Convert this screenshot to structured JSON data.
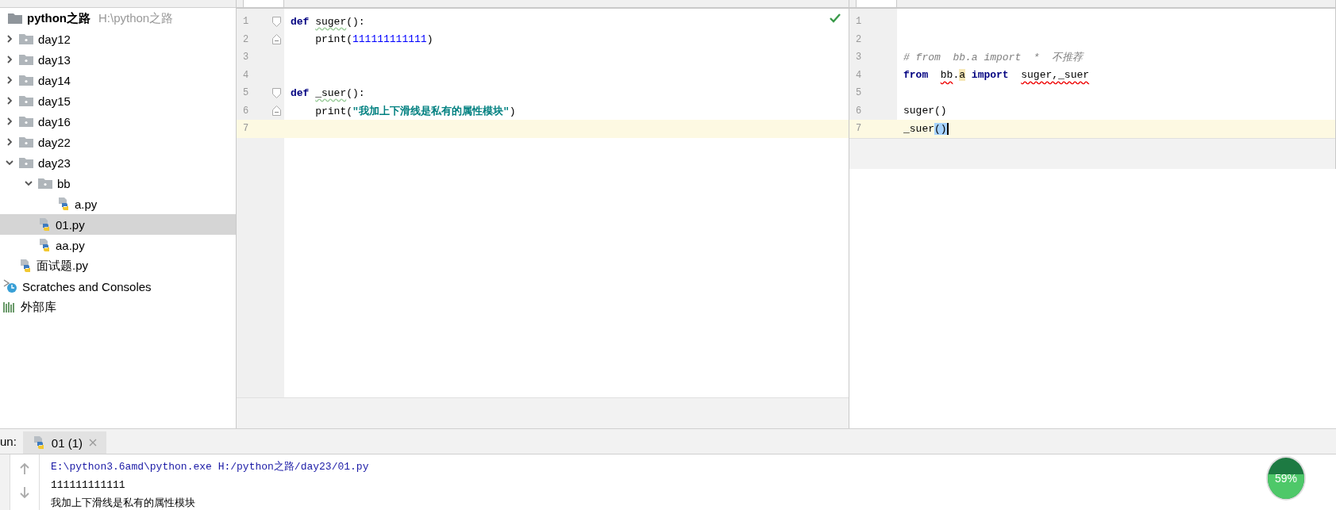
{
  "project_tree": {
    "root": {
      "name": "python之路",
      "path": "H:\\python之路"
    },
    "items": [
      {
        "kind": "folder",
        "name": "day12",
        "expanded": false,
        "selected": false
      },
      {
        "kind": "folder",
        "name": "day13",
        "expanded": false,
        "selected": false
      },
      {
        "kind": "folder",
        "name": "day14",
        "expanded": false,
        "selected": false
      },
      {
        "kind": "folder",
        "name": "day15",
        "expanded": false,
        "selected": false
      },
      {
        "kind": "folder",
        "name": "day16",
        "expanded": false,
        "selected": false
      },
      {
        "kind": "folder",
        "name": "day22",
        "expanded": false,
        "selected": false
      },
      {
        "kind": "folder",
        "name": "day23",
        "expanded": true,
        "selected": false,
        "children": [
          {
            "kind": "folder",
            "name": "bb",
            "expanded": true,
            "selected": false,
            "children": [
              {
                "kind": "file",
                "name": "a.py",
                "selected": false
              }
            ]
          },
          {
            "kind": "file",
            "name": "01.py",
            "selected": true
          },
          {
            "kind": "file",
            "name": "aa.py",
            "selected": false
          }
        ]
      },
      {
        "kind": "file",
        "name": "面试题.py",
        "selected": false
      }
    ],
    "extras": [
      {
        "kind": "scratches",
        "name": "Scratches and Consoles"
      },
      {
        "kind": "library",
        "name": "外部库"
      }
    ]
  },
  "editors": [
    {
      "inspection_ok": true,
      "lines": [
        {
          "number": "1",
          "kind": "foldstart",
          "current": false,
          "tokens": [
            {
              "kind": "keyword",
              "text": "def "
            },
            {
              "kind": "plain",
              "text": "suger",
              "typo": true
            },
            {
              "kind": "plain",
              "text": "():"
            }
          ]
        },
        {
          "number": "2",
          "kind": "foldend",
          "current": false,
          "tokens": [
            {
              "kind": "plain",
              "text": "    print("
            },
            {
              "kind": "number",
              "text": "111111111111"
            },
            {
              "kind": "plain",
              "text": ")"
            }
          ]
        },
        {
          "number": "3",
          "kind": "plain",
          "current": false
        },
        {
          "number": "4",
          "kind": "plain",
          "current": false
        },
        {
          "number": "5",
          "kind": "foldstart",
          "current": false,
          "tokens": [
            {
              "kind": "keyword",
              "text": "def "
            },
            {
              "kind": "plain",
              "text": "_suer",
              "typo": true
            },
            {
              "kind": "plain",
              "text": "():"
            }
          ]
        },
        {
          "number": "6",
          "kind": "foldend",
          "current": false,
          "tokens": [
            {
              "kind": "plain",
              "text": "    print("
            },
            {
              "kind": "string",
              "text": "\"我加上下滑线是私有的属性模块\""
            },
            {
              "kind": "plain",
              "text": ")"
            }
          ]
        },
        {
          "number": "7",
          "kind": "plain",
          "current": true
        }
      ]
    },
    {
      "inspection_ok": false,
      "lines": [
        {
          "number": "1",
          "kind": "plain",
          "current": false
        },
        {
          "number": "2",
          "kind": "plain",
          "current": false
        },
        {
          "number": "3",
          "kind": "plain",
          "current": false,
          "tokens": [
            {
              "kind": "comment",
              "text": "# from  bb.a import  *  不推荐"
            }
          ]
        },
        {
          "number": "4",
          "kind": "plain",
          "current": false,
          "tokens": [
            {
              "kind": "keyword",
              "text": "from  "
            },
            {
              "kind": "plain",
              "text": "bb",
              "error": true
            },
            {
              "kind": "plain",
              "text": "."
            },
            {
              "kind": "plain",
              "text": "a",
              "usage": true
            },
            {
              "kind": "keyword",
              "text": " import  "
            },
            {
              "kind": "plain",
              "text": "suger,_suer",
              "error": true
            }
          ]
        },
        {
          "number": "5",
          "kind": "plain",
          "current": false
        },
        {
          "number": "6",
          "kind": "plain",
          "current": false,
          "tokens": [
            {
              "kind": "plain",
              "text": "suger()"
            }
          ]
        },
        {
          "number": "7",
          "kind": "plain",
          "current": true,
          "tokens": [
            {
              "kind": "plain",
              "text": "_suer"
            },
            {
              "kind": "plain",
              "text": "()",
              "selection": true
            }
          ]
        }
      ]
    }
  ],
  "run": {
    "label": "un:",
    "tabs": [
      {
        "label": "01 (1)",
        "selected": true
      }
    ],
    "output": [
      {
        "kind": "command",
        "text": "E:\\python3.6amd\\python.exe H:/python之路/day23/01.py"
      },
      {
        "kind": "stdout",
        "text": "111111111111"
      },
      {
        "kind": "stdout",
        "text": "我加上下滑线是私有的属性模块"
      }
    ]
  },
  "meter": {
    "reading": "59%",
    "level": 0.59
  }
}
